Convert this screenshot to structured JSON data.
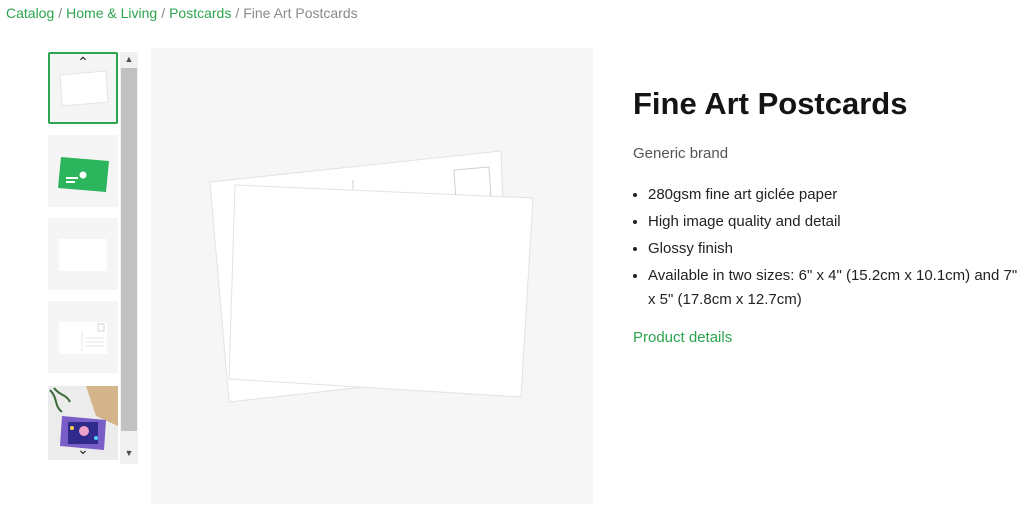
{
  "breadcrumb": [
    {
      "label": "Catalog"
    },
    {
      "label": "Home & Living"
    },
    {
      "label": "Postcards"
    }
  ],
  "breadcrumb_separator": "/",
  "breadcrumb_current": "Fine Art Postcards",
  "gallery": {
    "scroll_up_glyph": "▲",
    "scroll_down_glyph": "▼",
    "thumb_up_glyph": "⌃",
    "thumb_down_glyph": "⌄"
  },
  "product": {
    "title": "Fine Art Postcards",
    "brand": "Generic brand",
    "features": [
      "280gsm fine art giclée paper",
      "High image quality and detail",
      "Glossy finish",
      "Available in two sizes: 6\" x 4\" (15.2cm x 10.1cm) and 7\" x 5\" (17.8cm x 12.7cm)"
    ],
    "details_link": "Product details"
  },
  "colors": {
    "accent": "#2da44e",
    "active_border": "#2da44e"
  }
}
